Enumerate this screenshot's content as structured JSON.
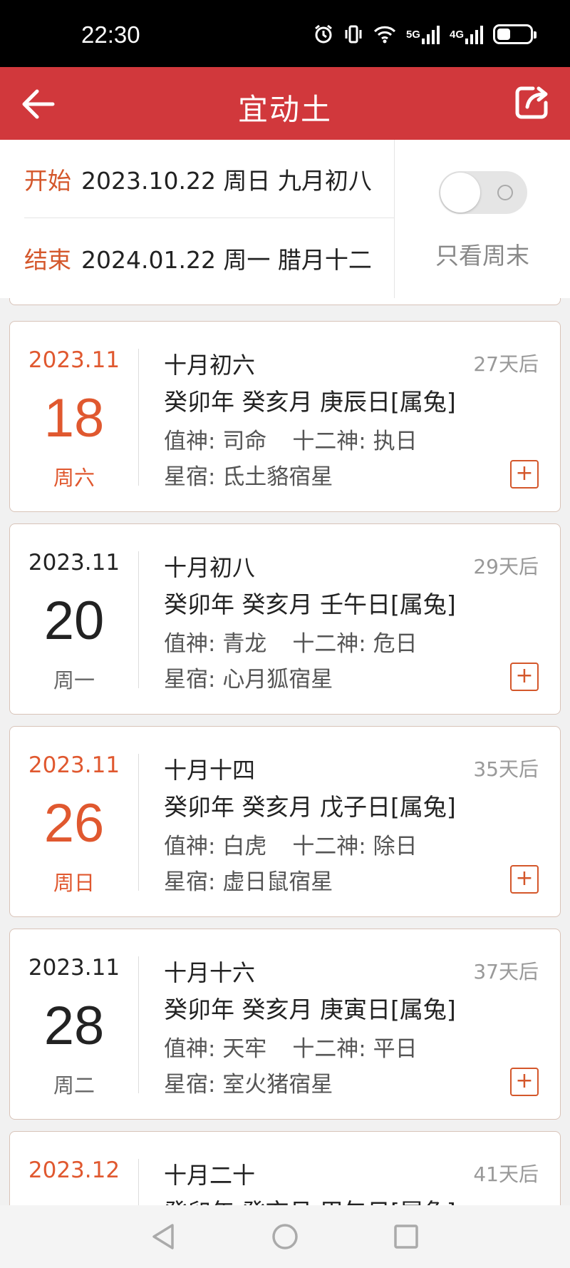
{
  "status": {
    "time": "22:30",
    "net1": "5G",
    "net2": "4G",
    "battery_level": 0.4
  },
  "header": {
    "title": "宜动土",
    "back_icon": "arrow-left-icon",
    "share_icon": "share-icon"
  },
  "range": {
    "start_label": "开始",
    "start_value": "2023.10.22 周日 九月初八",
    "end_label": "结束",
    "end_value": "2024.01.22 周一 腊月十二",
    "weekend_only_label": "只看周末",
    "weekend_only_on": false
  },
  "colors": {
    "accent": "#d1383c",
    "highlight": "#e0582f"
  },
  "cards": [
    {
      "ym": "2023.11",
      "day": "18",
      "weekday": "周六",
      "lunar": "十月初六",
      "ganzhi": "癸卯年 癸亥月 庚辰日[属兔]",
      "zhishen_label": "值神:",
      "zhishen": "司命",
      "shier_label": "十二神:",
      "shier": "执日",
      "xingxiu_label": "星宿:",
      "xingxiu": "氐土貉宿星",
      "after": "27天后",
      "add": "+",
      "weekend": true
    },
    {
      "ym": "2023.11",
      "day": "20",
      "weekday": "周一",
      "lunar": "十月初八",
      "ganzhi": "癸卯年 癸亥月 壬午日[属兔]",
      "zhishen_label": "值神:",
      "zhishen": "青龙",
      "shier_label": "十二神:",
      "shier": "危日",
      "xingxiu_label": "星宿:",
      "xingxiu": "心月狐宿星",
      "after": "29天后",
      "add": "+",
      "weekend": false
    },
    {
      "ym": "2023.11",
      "day": "26",
      "weekday": "周日",
      "lunar": "十月十四",
      "ganzhi": "癸卯年 癸亥月 戊子日[属兔]",
      "zhishen_label": "值神:",
      "zhishen": "白虎",
      "shier_label": "十二神:",
      "shier": "除日",
      "xingxiu_label": "星宿:",
      "xingxiu": "虚日鼠宿星",
      "after": "35天后",
      "add": "+",
      "weekend": true
    },
    {
      "ym": "2023.11",
      "day": "28",
      "weekday": "周二",
      "lunar": "十月十六",
      "ganzhi": "癸卯年 癸亥月 庚寅日[属兔]",
      "zhishen_label": "值神:",
      "zhishen": "天牢",
      "shier_label": "十二神:",
      "shier": "平日",
      "xingxiu_label": "星宿:",
      "xingxiu": "室火猪宿星",
      "after": "37天后",
      "add": "+",
      "weekend": false
    },
    {
      "ym": "2023.12",
      "day": "",
      "weekday": "",
      "lunar": "十月二十",
      "ganzhi": "癸卯年 癸亥月 甲午日[属兔]",
      "zhishen_label": "",
      "zhishen": "",
      "shier_label": "",
      "shier": "",
      "xingxiu_label": "",
      "xingxiu": "",
      "after": "41天后",
      "add": "",
      "weekend": true
    }
  ],
  "nav": {
    "back": "triangle-back-icon",
    "home": "circle-home-icon",
    "recent": "square-recent-icon"
  }
}
